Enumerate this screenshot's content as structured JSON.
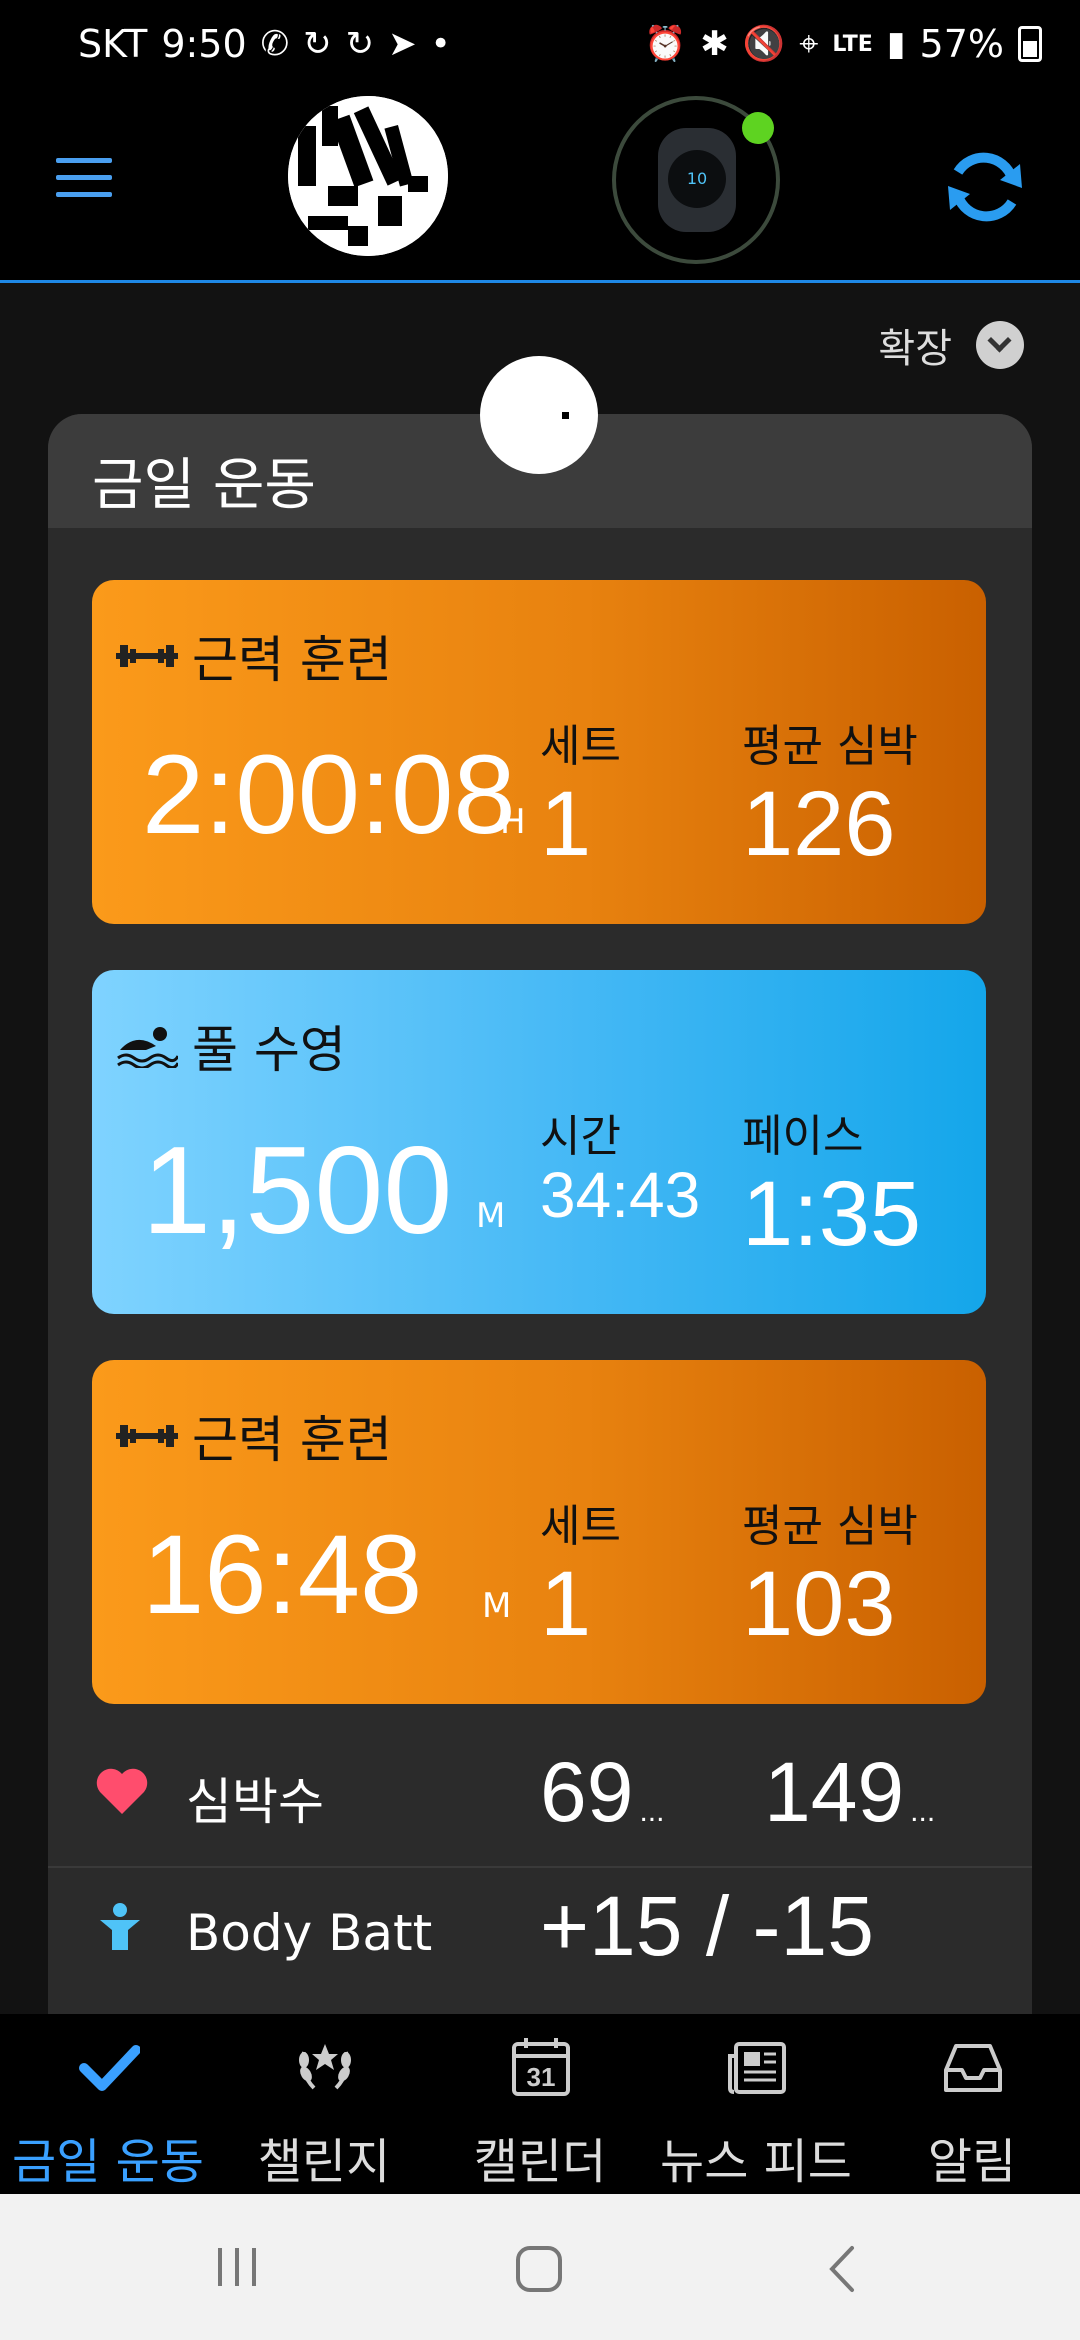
{
  "status_bar": {
    "carrier": "SKT",
    "time": "9:50",
    "network": "LTE",
    "battery": "57%"
  },
  "header": {
    "expand_label": "확장"
  },
  "section": {
    "title": "금일 운동"
  },
  "activities": [
    {
      "name": "근력 훈련",
      "main_value": "2:00:08",
      "main_unit": "H",
      "stat1_label": "세트",
      "stat1_value": "1",
      "stat2_label": "평균 심박",
      "stat2_value": "126",
      "icon": "dumbbell-icon"
    },
    {
      "name": "풀 수영",
      "main_value": "1,500",
      "main_unit": "M",
      "stat1_label": "시간",
      "stat1_value": "34:43",
      "stat2_label": "페이스",
      "stat2_value": "1:35",
      "icon": "swimmer-icon"
    },
    {
      "name": "근력 훈련",
      "main_value": "16:48",
      "main_unit": "M",
      "stat1_label": "세트",
      "stat1_value": "1",
      "stat2_label": "평균 심박",
      "stat2_value": "103",
      "icon": "dumbbell-icon"
    }
  ],
  "heart_rate": {
    "label": "심박수",
    "value1": "69",
    "value2": "149",
    "ellipsis": "...",
    "color": "#ff4d6d"
  },
  "body_battery": {
    "label_partial": "Body Batt",
    "value": "+15 / -15"
  },
  "bottom_nav": [
    {
      "label": "금일 운동",
      "icon": "checkmark-icon",
      "active": true
    },
    {
      "label": "챌린지",
      "icon": "laurel-icon",
      "active": false
    },
    {
      "label": "캘린더",
      "icon": "calendar-icon",
      "active": false,
      "badge": "31"
    },
    {
      "label": "뉴스 피드",
      "icon": "newspaper-icon",
      "active": false
    },
    {
      "label": "알림",
      "icon": "inbox-icon",
      "active": false
    }
  ],
  "colors": {
    "accent_blue": "#3aa0ff",
    "strength_orange": "#f08a12",
    "swim_blue": "#3ab4f2",
    "device_connected_green": "#5ed321"
  }
}
